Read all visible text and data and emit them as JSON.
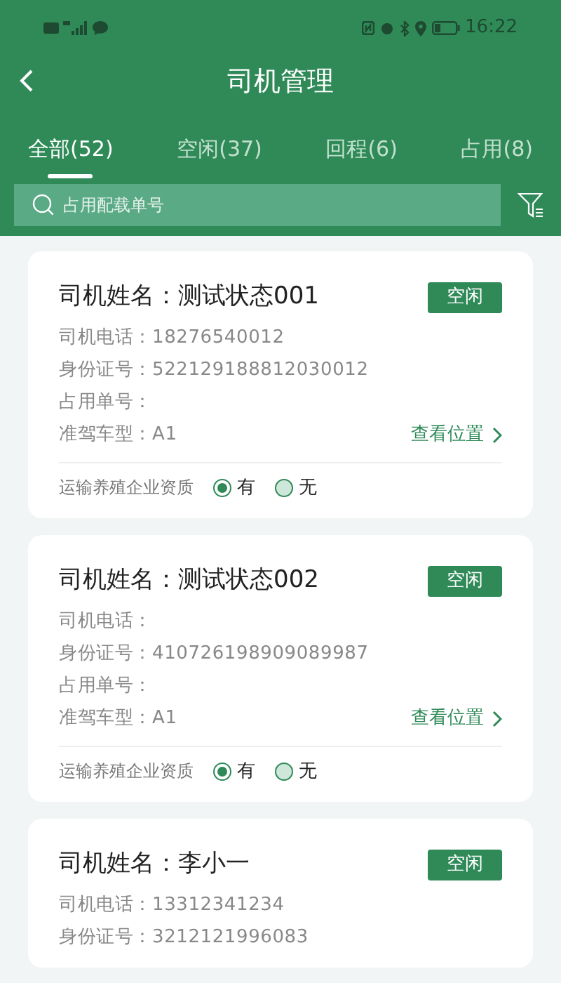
{
  "status_bar": {
    "time": "16:22"
  },
  "header": {
    "title": "司机管理"
  },
  "tabs": [
    {
      "label": "全部(52)",
      "selected": true
    },
    {
      "label": "空闲(37)",
      "selected": false
    },
    {
      "label": "回程(6)",
      "selected": false
    },
    {
      "label": "占用(8)",
      "selected": false
    }
  ],
  "search": {
    "placeholder": "占用配载单号"
  },
  "drivers": [
    {
      "name": "司机姓名：测试状态001",
      "status": "空闲",
      "fields": [
        "司机电话：18276540012",
        "身份证号：522129188812030012",
        "占用单号：",
        "准驾车型：A1"
      ],
      "location_link": "查看位置",
      "qualification": {
        "label": "运输养殖企业资质",
        "options": [
          {
            "label": "有",
            "selected": true
          },
          {
            "label": "无",
            "selected": false
          }
        ]
      }
    },
    {
      "name": "司机姓名：测试状态002",
      "status": "空闲",
      "fields": [
        "司机电话：",
        "身份证号：410726198909089987",
        "占用单号：",
        "准驾车型：A1"
      ],
      "location_link": "查看位置",
      "qualification": {
        "label": "运输养殖企业资质",
        "options": [
          {
            "label": "有",
            "selected": true
          },
          {
            "label": "无",
            "selected": false
          }
        ]
      }
    },
    {
      "name": "司机姓名：李小一",
      "status": "空闲",
      "fields": [
        "司机电话：13312341234",
        "身份证号：3212121996083"
      ]
    }
  ]
}
